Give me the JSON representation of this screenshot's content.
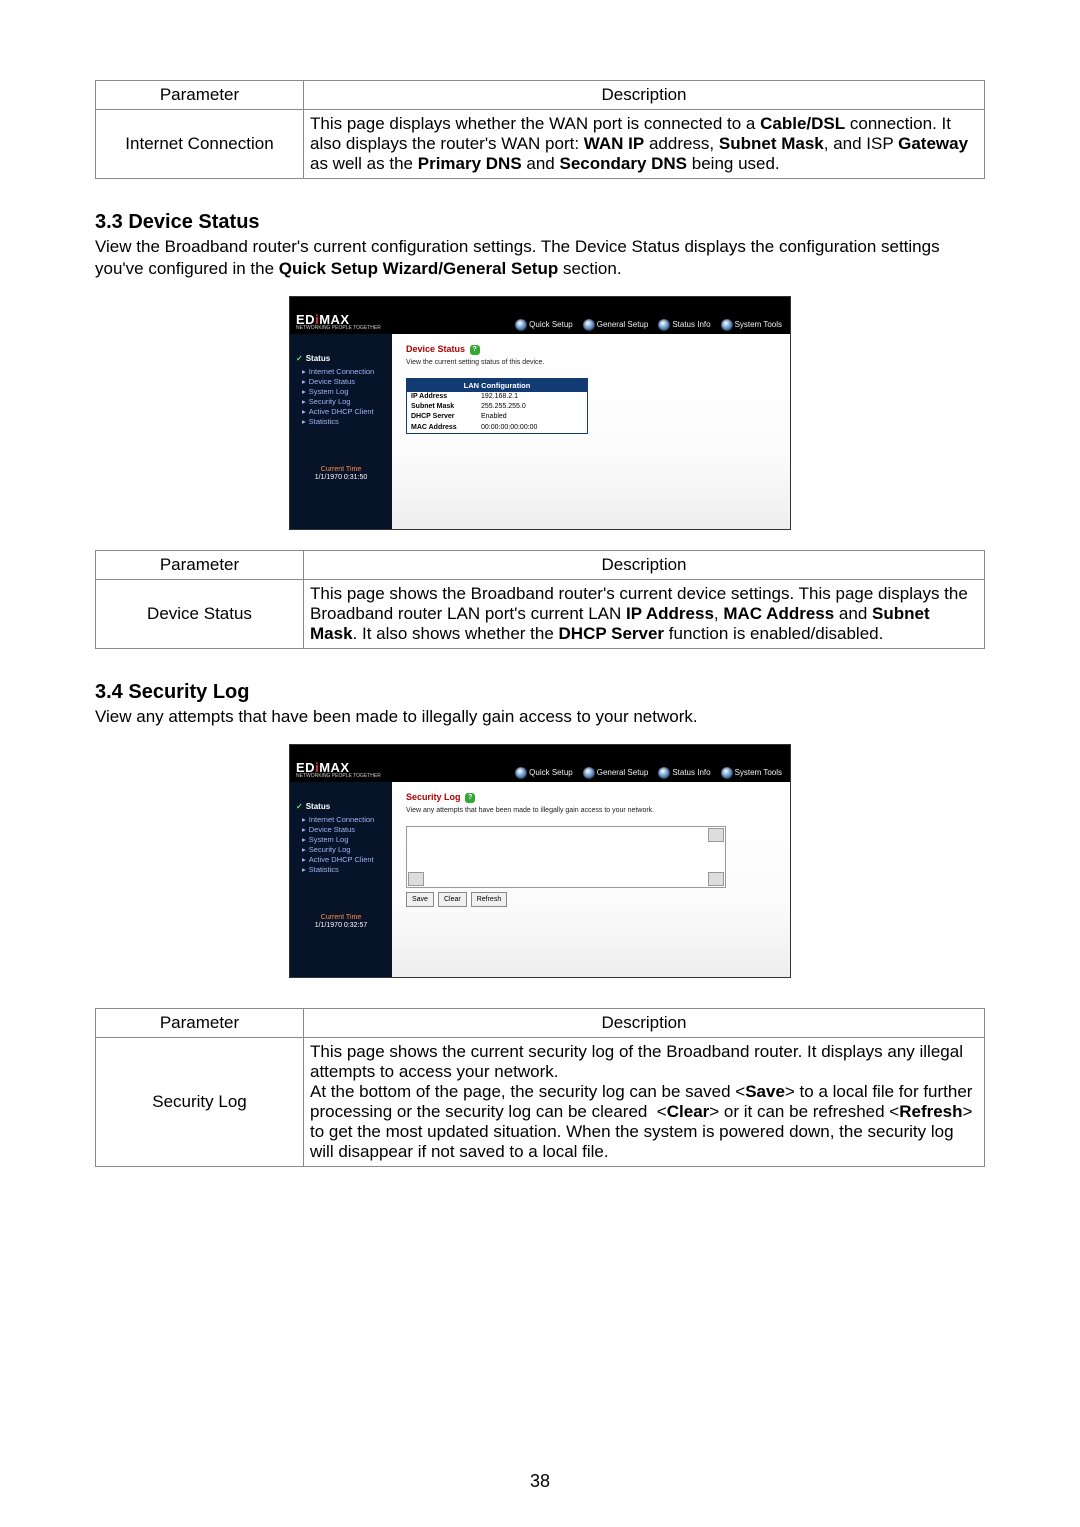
{
  "page_number": "38",
  "table1": {
    "headers": [
      "Parameter",
      "Description"
    ],
    "row": {
      "param": "Internet Connection",
      "desc_html": "This page displays whether the WAN port is connected to a <b>Cable/DSL</b> connection. It also displays the router's WAN port: <b>WAN IP</b> address, <b>Subnet Mask</b>, and ISP <b>Gateway</b> as well as the <b>Primary DNS</b> and <b>Secondary DNS</b> being used."
    }
  },
  "section_ds": {
    "heading": "3.3 Device Status",
    "intro_html": "View the Broadband router's current configuration settings. The Device Status displays the configuration settings you've configured in the <b>Quick Setup Wizard/General Setup</b> section."
  },
  "ui_common": {
    "brand": "EDIMAX",
    "brand_tag": "NETWORKING PEOPLE TOGETHER",
    "nav": [
      "Quick Setup",
      "General Setup",
      "Status Info",
      "System Tools"
    ],
    "side_header": "Status",
    "side_items": [
      "Internet Connection",
      "Device Status",
      "System Log",
      "Security Log",
      "Active DHCP Client",
      "Statistics"
    ],
    "current_time_label": "Current Time"
  },
  "ui_ds": {
    "title": "Device Status",
    "desc": "View the current setting status of this device.",
    "box_title": "LAN Configuration",
    "rows": [
      {
        "k": "IP Address",
        "v": "192.168.2.1"
      },
      {
        "k": "Subnet Mask",
        "v": "255.255.255.0"
      },
      {
        "k": "DHCP Server",
        "v": "Enabled"
      },
      {
        "k": "MAC Address",
        "v": "00:00:00:00:00:00"
      }
    ],
    "time": "1/1/1970 0:31:50"
  },
  "table2": {
    "headers": [
      "Parameter",
      "Description"
    ],
    "row": {
      "param": "Device Status",
      "desc_html": "This page shows the Broadband router's current device settings. This page displays the Broadband router LAN port's current LAN <b>IP Address</b>, <b>MAC Address</b> and <b>Subnet Mask</b>. It also shows whether the <b>DHCP Server</b> function is enabled/disabled."
    }
  },
  "section_sl": {
    "heading": "3.4 Security Log",
    "intro": "View any attempts that have been made to illegally gain access to your network."
  },
  "ui_sl": {
    "title": "Security Log",
    "desc": "View any attempts that have been made to illegally gain access to your network.",
    "buttons": [
      "Save",
      "Clear",
      "Refresh"
    ],
    "time": "1/1/1970 0:32:57"
  },
  "table3": {
    "headers": [
      "Parameter",
      "Description"
    ],
    "row": {
      "param": "Security Log",
      "desc_html": "This page shows the current security log of the Broadband router. It displays any illegal attempts to access your network.<br>At the bottom of the page, the security log can be saved &lt;<b>Save</b>&gt; to a local file for further processing or the security log can be cleared &nbsp;&lt;<b>Clear</b>&gt; or it can be refreshed &lt;<b>Refresh</b>&gt; to get the most updated situation. When the system is powered down, the security log will disappear if not saved to a local file."
    }
  }
}
